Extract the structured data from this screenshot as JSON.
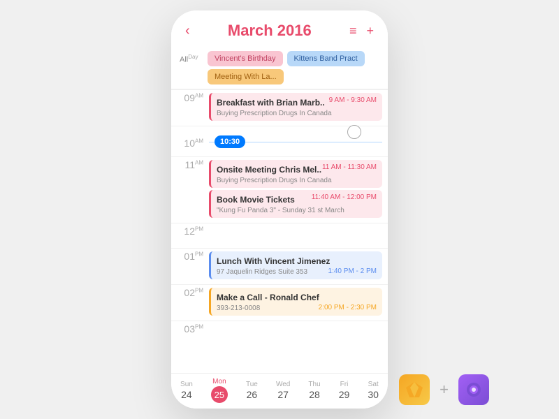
{
  "header": {
    "back_icon": "‹",
    "title": "March 2016",
    "menu_icon": "≡",
    "add_icon": "+"
  },
  "all_day": {
    "label": "All",
    "sup": "Day",
    "row1": [
      {
        "text": "Vincent's Birthday",
        "style": "chip-pink"
      },
      {
        "text": "Kittens Band Pract",
        "style": "chip-blue"
      }
    ],
    "row2": [
      {
        "text": "Meeting With La...",
        "style": "chip-orange"
      }
    ]
  },
  "time_slots": [
    {
      "hour": "09",
      "sup": "AM",
      "events": [
        {
          "title": "Breakfast with Brian Marb..",
          "time": "9 AM - 9:30 AM",
          "sub": "Buying Prescription Drugs In Canada",
          "style": "event-card-red",
          "time_style": ""
        }
      ]
    },
    {
      "hour": "10",
      "sup": "AM",
      "current_time": "10:30",
      "events": []
    },
    {
      "hour": "11",
      "sup": "AM",
      "events": [
        {
          "title": "Onsite Meeting Chris Mel..",
          "time": "11 AM - 11:30 AM",
          "sub": "Buying Prescription Drugs In Canada",
          "style": "event-card-red",
          "time_style": ""
        },
        {
          "title": "Book Movie Tickets",
          "time": "11:40 AM - 12:00 PM",
          "sub": "\"Kung Fu Panda 3\" - Sunday 31 st March",
          "style": "event-card-red",
          "time_style": ""
        }
      ]
    },
    {
      "hour": "12",
      "sup": "PM",
      "events": []
    },
    {
      "hour": "01",
      "sup": "PM",
      "events": [
        {
          "title": "Lunch With Vincent Jimenez",
          "time": "1:40 PM - 2 PM",
          "sub": "97 Jaquelin Ridges Suite 353",
          "style": "event-card-blue",
          "time_style": "event-time-blue"
        }
      ]
    },
    {
      "hour": "02",
      "sup": "PM",
      "events": [
        {
          "title": "Make a Call - Ronald Chef",
          "time": "2:00 PM - 2:30 PM",
          "sub": "393-213-0008",
          "style": "event-card-orange",
          "time_style": "event-time-orange"
        }
      ]
    },
    {
      "hour": "03",
      "sup": "PM",
      "events": []
    }
  ],
  "week": {
    "days": [
      {
        "name": "Sun",
        "num": "24",
        "active": false
      },
      {
        "name": "Mon",
        "num": "25",
        "active": true
      },
      {
        "name": "Tue",
        "num": "26",
        "active": false
      },
      {
        "name": "Wed",
        "num": "27",
        "active": false
      },
      {
        "name": "Thu",
        "num": "28",
        "active": false
      },
      {
        "name": "Fri",
        "num": "29",
        "active": false
      },
      {
        "name": "Sat",
        "num": "30",
        "active": false
      }
    ]
  }
}
